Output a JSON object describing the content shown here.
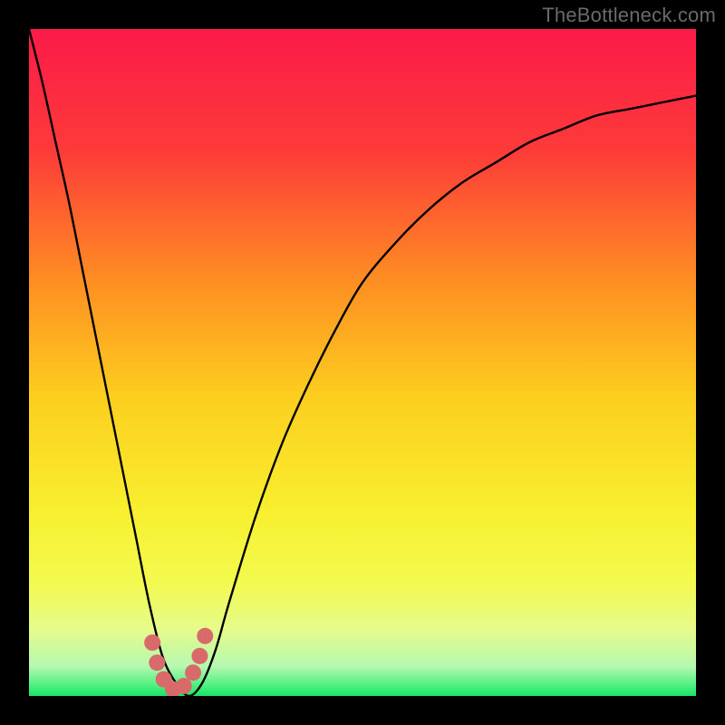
{
  "watermark": "TheBottleneck.com",
  "chart_data": {
    "type": "line",
    "title": "",
    "xlabel": "",
    "ylabel": "",
    "xlim": [
      0,
      100
    ],
    "ylim": [
      0,
      100
    ],
    "grid": false,
    "series": [
      {
        "name": "bottleneck-curve",
        "x": [
          0,
          2,
          4,
          6,
          8,
          10,
          12,
          14,
          16,
          18,
          20,
          22,
          24,
          26,
          28,
          30,
          34,
          38,
          42,
          46,
          50,
          55,
          60,
          65,
          70,
          75,
          80,
          85,
          90,
          95,
          100
        ],
        "y": [
          100,
          92,
          83,
          74,
          64,
          54,
          44,
          34,
          24,
          14,
          6,
          2,
          0,
          2,
          7,
          14,
          27,
          38,
          47,
          55,
          62,
          68,
          73,
          77,
          80,
          83,
          85,
          87,
          88,
          89,
          90
        ]
      }
    ],
    "markers": {
      "name": "trough-markers",
      "color": "#d96a6a",
      "x": [
        18.5,
        19.2,
        20.2,
        21.6,
        23.2,
        24.6,
        25.6,
        26.4
      ],
      "y": [
        8.0,
        5.0,
        2.5,
        1.0,
        1.5,
        3.5,
        6.0,
        9.0
      ]
    },
    "background_gradient": {
      "stops": [
        {
          "pos": 0.0,
          "color": "#fb1b4a"
        },
        {
          "pos": 0.18,
          "color": "#fd3a39"
        },
        {
          "pos": 0.38,
          "color": "#fe8f23"
        },
        {
          "pos": 0.55,
          "color": "#fcce1e"
        },
        {
          "pos": 0.72,
          "color": "#f8ef2e"
        },
        {
          "pos": 0.83,
          "color": "#f3fa4f"
        },
        {
          "pos": 0.9,
          "color": "#e6fb8b"
        },
        {
          "pos": 0.955,
          "color": "#b6f9b0"
        },
        {
          "pos": 0.985,
          "color": "#4cf07e"
        },
        {
          "pos": 1.0,
          "color": "#18e566"
        }
      ]
    }
  }
}
